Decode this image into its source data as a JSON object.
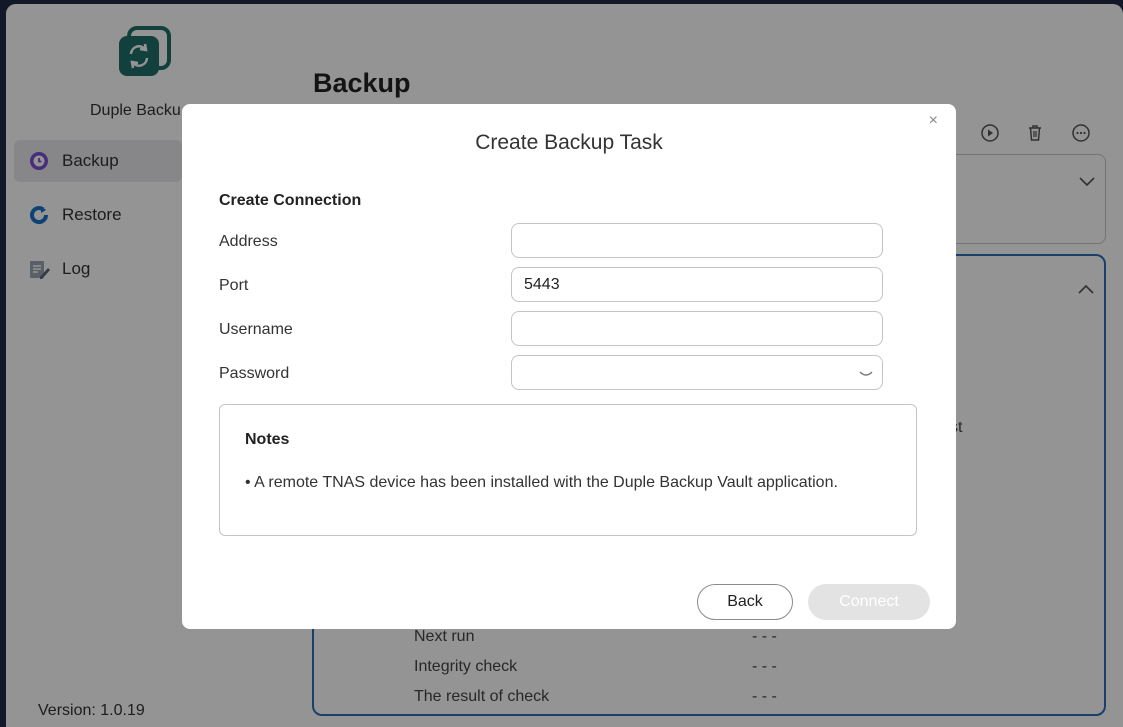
{
  "app": {
    "name": "Duple Backup",
    "name_visible": "Duple Backu",
    "version": "Version: 1.0.19",
    "brand_color": "#1f6f6a"
  },
  "sidebar": {
    "items": [
      {
        "label": "Backup",
        "icon": "clock-icon",
        "active": true
      },
      {
        "label": "Restore",
        "icon": "restore-icon",
        "active": false
      },
      {
        "label": "Log",
        "icon": "log-icon",
        "active": false
      }
    ]
  },
  "main": {
    "title": "Backup",
    "toolbar": {
      "icons": [
        "play-icon",
        "trash-icon",
        "more-icon"
      ]
    },
    "partial_text": "st",
    "details": [
      {
        "label": "Next run",
        "value": "- - -"
      },
      {
        "label": "Integrity check",
        "value": "- - -"
      },
      {
        "label": "The result of check",
        "value": "- - -"
      }
    ]
  },
  "dialog": {
    "close": "×",
    "title": "Create Backup Task",
    "section": "Create Connection",
    "fields": {
      "address": {
        "label": "Address",
        "value": ""
      },
      "port": {
        "label": "Port",
        "value": "5443"
      },
      "username": {
        "label": "Username",
        "value": ""
      },
      "password": {
        "label": "Password",
        "value": ""
      }
    },
    "notes": {
      "title": "Notes",
      "text": "• A remote TNAS device has been installed with the Duple Backup Vault application."
    },
    "buttons": {
      "back": "Back",
      "connect": "Connect"
    }
  },
  "colors": {
    "accent_border": "#2a6fb8",
    "overlay": "rgba(0,0,0,0.42)"
  }
}
